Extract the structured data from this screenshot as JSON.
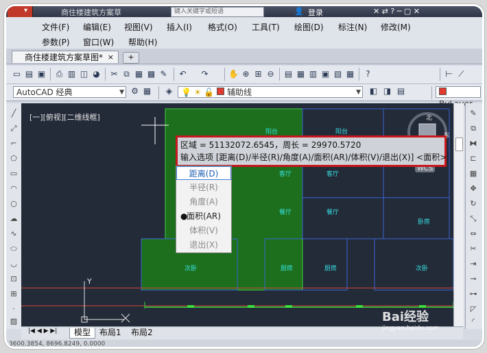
{
  "titlebar": {
    "title": "商住楼建筑方案草",
    "search_placeholder": "键入关键字或短语",
    "login": "登录"
  },
  "menu": {
    "row1": [
      "文件(F)",
      "编辑(E)",
      "视图(V)",
      "插入(I)",
      "格式(O)",
      "工具(T)",
      "绘图(D)",
      "标注(N)",
      "修改(M)"
    ],
    "row2": [
      "参数(P)",
      "窗口(W)",
      "帮助(H)"
    ]
  },
  "tabs": {
    "doc_tab": "商住楼建筑方案草图*",
    "close": "×",
    "new_tab": "+"
  },
  "toolbar2": {
    "workspace": "AutoCAD 经典",
    "layer": "辅助线",
    "color": "ByLayer"
  },
  "canvas": {
    "view_label": "[一][俯视][二维线框]",
    "rooms": [
      "阳台",
      "阳台",
      "客厅",
      "客厅",
      "餐厅",
      "餐厅",
      "卧房",
      "次卧",
      "厨房",
      "厨房",
      "次卧"
    ],
    "compass_labels": [
      "北",
      "东"
    ],
    "wcs": "WCS",
    "ucs_y": "Y"
  },
  "command": {
    "line1": "区域 = 51132072.6545，周长 = 29970.5720",
    "line2": "输入选项 [距离(D)/半径(R)/角度(A)/面积(AR)/体积(V)/退出(X)] <面积>:"
  },
  "options": [
    "距离(D)",
    "半径(R)",
    "角度(A)",
    "面积(AR)",
    "体积(V)",
    "退出(X)"
  ],
  "layout_tabs": [
    "模型",
    "布局1",
    "布局2"
  ],
  "status": {
    "coords": "3600.3854, 8696.8249, 0.0000"
  },
  "watermark": {
    "text": "Bai经验",
    "sub": "jingyan.baidu.com"
  }
}
